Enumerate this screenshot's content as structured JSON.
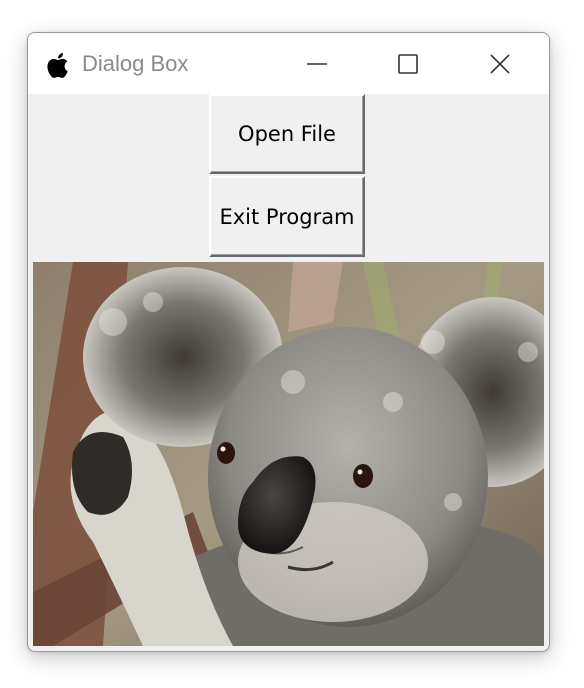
{
  "window": {
    "title": "Dialog Box",
    "controls": {
      "minimize_icon": "minimize-icon",
      "maximize_icon": "maximize-icon",
      "close_icon": "close-icon"
    }
  },
  "buttons": {
    "open_label": "Open File",
    "exit_label": "Exit Program"
  },
  "image": {
    "subject": "koala photograph"
  },
  "colors": {
    "window_bg": "#f0f0f0",
    "titlebar_bg": "#ffffff",
    "title_text": "#8a8a8a"
  }
}
